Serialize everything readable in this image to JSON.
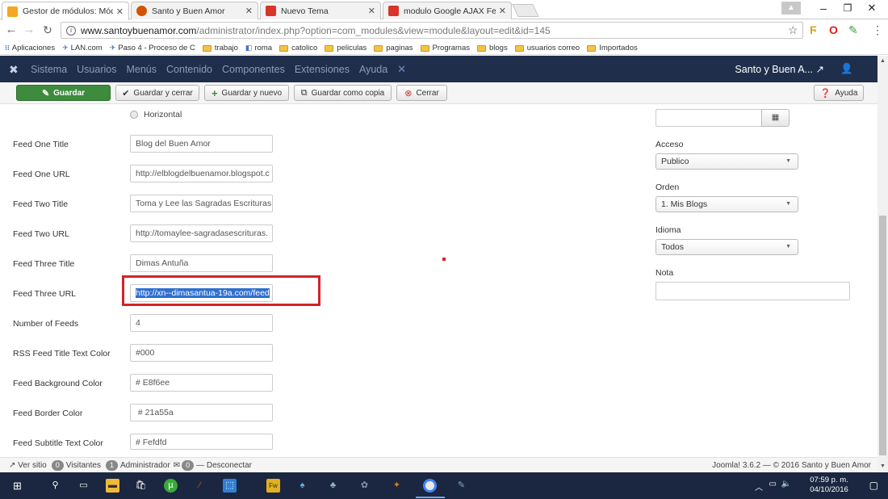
{
  "browser": {
    "tabs": [
      {
        "label": "Gestor de módulos: Mód",
        "icon": "joomla-icon",
        "color": "#f5a623"
      },
      {
        "label": "Santo y Buen Amor",
        "icon": "site-icon",
        "color": "#d35400"
      },
      {
        "label": "Nuevo Tema",
        "icon": "blogger-icon",
        "color": "#d9342b"
      },
      {
        "label": "modulo Google AJAX Fe",
        "icon": "blogger-icon",
        "color": "#d9342b"
      }
    ],
    "url_domain": "www.santoybuenamor.com",
    "url_path": "/administrator/index.php?option=com_modules&view=module&layout=edit&id=145",
    "bookmarks": [
      {
        "label": "Aplicaciones",
        "type": "apps"
      },
      {
        "label": "LAN.com",
        "type": "link"
      },
      {
        "label": "Paso 4 - Proceso de C",
        "type": "link"
      },
      {
        "label": "trabajo",
        "type": "folder"
      },
      {
        "label": "roma",
        "type": "link"
      },
      {
        "label": "catolico",
        "type": "folder"
      },
      {
        "label": "peliculas",
        "type": "folder"
      },
      {
        "label": "paginas",
        "type": "folder"
      },
      {
        "label": "Programas",
        "type": "folder"
      },
      {
        "label": "blogs",
        "type": "folder"
      },
      {
        "label": "usuarios correo",
        "type": "folder"
      },
      {
        "label": "Importados",
        "type": "folder"
      }
    ]
  },
  "joomla": {
    "menu": [
      "Sistema",
      "Usuarios",
      "Menús",
      "Contenido",
      "Componentes",
      "Extensiones",
      "Ayuda"
    ],
    "user": "Santo y Buen A...",
    "toolbar": {
      "save": "Guardar",
      "save_close": "Guardar y cerrar",
      "save_new": "Guardar y nuevo",
      "save_copy": "Guardar como copia",
      "close": "Cerrar",
      "help": "Ayuda"
    }
  },
  "form": {
    "radio_option": "Horizontal",
    "fields": [
      {
        "label": "Feed One Title",
        "value": "Blog del Buen Amor"
      },
      {
        "label": "Feed One URL",
        "value": "http://elblogdelbuenamor.blogspot.c"
      },
      {
        "label": "Feed Two Title",
        "value": "Toma y Lee las Sagradas Escrituras"
      },
      {
        "label": "Feed Two URL",
        "value": "http://tomaylee-sagradasescrituras."
      },
      {
        "label": "Feed Three Title",
        "value": "Dimas Antuña"
      },
      {
        "label": "Feed Three URL",
        "value": "http://xn--dimasantua-19a.com/feed"
      },
      {
        "label": "Number of Feeds",
        "value": "4"
      },
      {
        "label": "RSS Feed Title Text Color",
        "value": "#000"
      },
      {
        "label": "Feed Background Color",
        "value": "# E8f6ee"
      },
      {
        "label": "Feed Border Color",
        "value": " # 21a55a"
      },
      {
        "label": "Feed Subtitle Text Color",
        "value": "# Fefdfd"
      }
    ]
  },
  "sidebar": {
    "access_label": "Acceso",
    "access_value": "Publico",
    "order_label": "Orden",
    "order_value": "1. Mis Blogs",
    "language_label": "Idioma",
    "language_value": "Todos",
    "note_label": "Nota",
    "note_value": ""
  },
  "status": {
    "view_site": "Ver sitio",
    "visitors_count": "0",
    "visitors": "Visitantes",
    "admin_count": "1",
    "admin": "Administrador",
    "messages_count": "0",
    "logout": "Desconectar",
    "footer": "Joomla! 3.6.2 — © 2016 Santo y Buen Amor"
  },
  "taskbar": {
    "time": "07:59 p. m.",
    "date": "04/10/2016"
  },
  "colors": {
    "joomla_nav": "#1f2e4b",
    "save_green": "#3d8b3d",
    "highlight_red": "#d2232a",
    "taskbar": "#1b2740"
  }
}
